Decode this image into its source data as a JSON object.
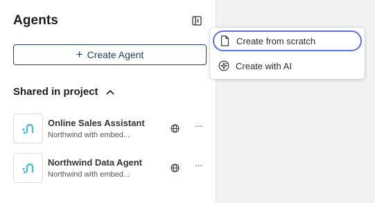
{
  "panel": {
    "title": "Agents",
    "create_button_label": "Create Agent",
    "section_title": "Shared in project"
  },
  "agents": [
    {
      "name": "Online Sales Assistant",
      "description": "Northwind with embed..."
    },
    {
      "name": "Northwind Data Agent",
      "description": "Northwind with embed..."
    }
  ],
  "create_menu": {
    "items": [
      {
        "label": "Create from scratch",
        "icon": "document-icon",
        "focused": true
      },
      {
        "label": "Create with AI",
        "icon": "ai-sparkle-icon",
        "focused": false
      }
    ]
  },
  "colors": {
    "accent": "#1f3f66",
    "focus_ring": "#5a6fe0",
    "agent_logo": "#4fb8c9",
    "background": "#f2f2f2"
  }
}
